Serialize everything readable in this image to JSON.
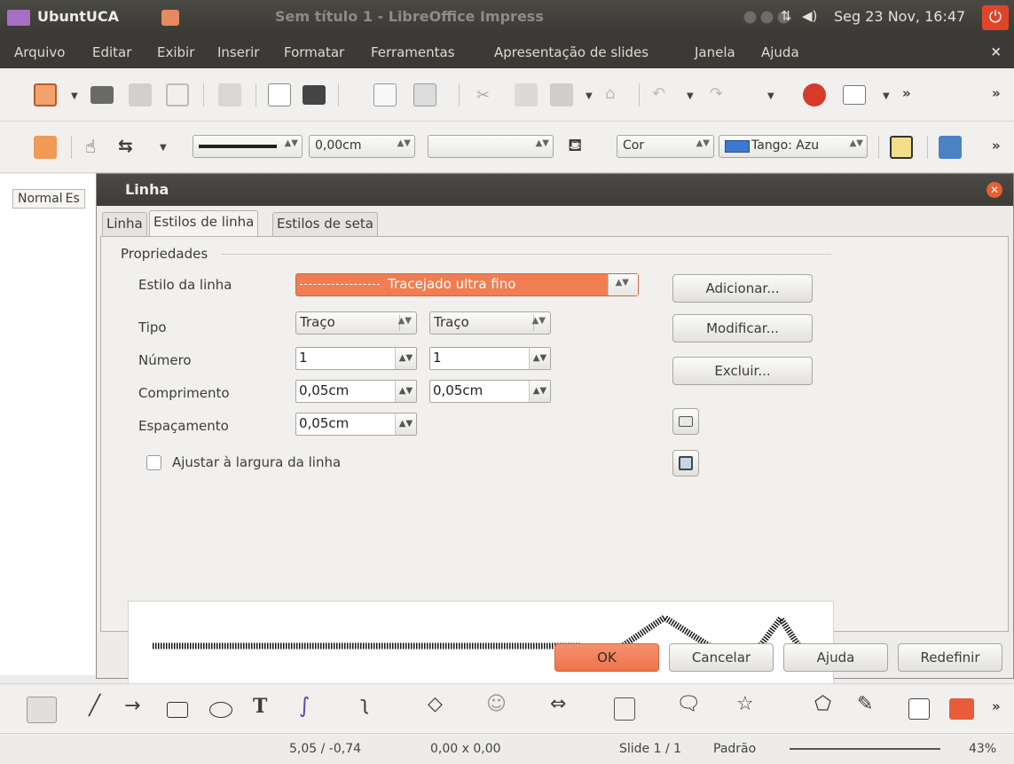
{
  "top_panel": {
    "app_name": "UbuntUCA",
    "window_title": "Sem título 1 - LibreOffice Impress",
    "clock": "Seg 23 Nov, 16:47"
  },
  "menu": {
    "items": [
      "Arquivo",
      "Editar",
      "Exibir",
      "Inserir",
      "Formatar",
      "Ferramentas",
      "Apresentação de slides",
      "Janela",
      "Ajuda"
    ],
    "close": "×"
  },
  "toolbar2": {
    "line_width": "0,00cm",
    "color_label": "Cor",
    "fill_label": "Tango: Azu"
  },
  "left_pane": {
    "tab_normal": "Normal",
    "tab_other": "Es"
  },
  "dialog": {
    "title": "Linha",
    "tabs": [
      "Linha",
      "Estilos de linha",
      "Estilos de seta"
    ],
    "group_title": "Propriedades",
    "labels": {
      "line_style": "Estilo da linha",
      "type": "Tipo",
      "number": "Número",
      "length": "Comprimento",
      "spacing": "Espaçamento",
      "fit": "Ajustar à largura da linha"
    },
    "line_style_value": "Tracejado ultra fino",
    "type_1": "Traço",
    "type_2": "Traço",
    "number_1": "1",
    "number_2": "1",
    "length_1": "0,05cm",
    "length_2": "0,05cm",
    "spacing": "0,05cm",
    "fit_checked": false,
    "buttons": {
      "add": "Adicionar...",
      "modify": "Modificar...",
      "delete": "Excluir...",
      "ok": "OK",
      "cancel": "Cancelar",
      "help": "Ajuda",
      "reset": "Redefinir"
    }
  },
  "status": {
    "position": "5,05 / -0,74",
    "size": "0,00 x 0,00",
    "slide": "Slide 1 / 1",
    "layout": "Padrão",
    "zoom": "43%"
  },
  "colors": {
    "accent": "#ec744b",
    "panel": "#3b3a36"
  }
}
